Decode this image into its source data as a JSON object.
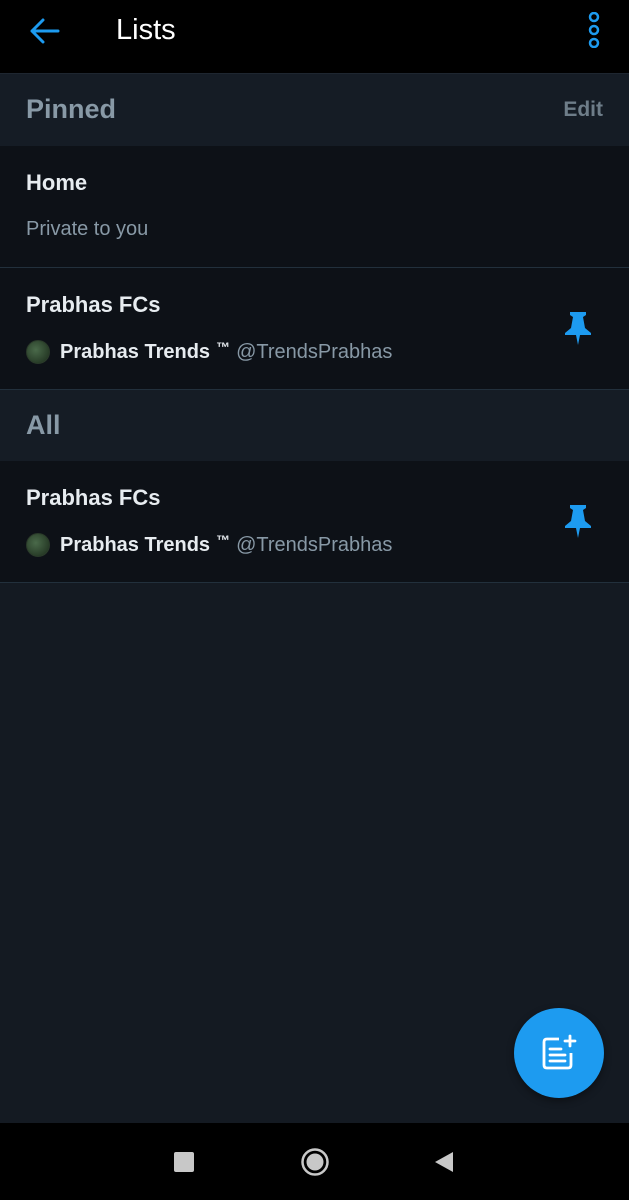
{
  "header": {
    "title": "Lists",
    "back_icon": "arrow-left-icon",
    "more_icon": "more-vertical-icon"
  },
  "pinned_section": {
    "label": "Pinned",
    "edit_label": "Edit",
    "items": [
      {
        "name": "Home",
        "subtitle": "Private to you"
      },
      {
        "name": "Prabhas FCs",
        "owner_name": "Prabhas Trends",
        "owner_mark": "™",
        "owner_handle": "@TrendsPrabhas",
        "pinned": true
      }
    ]
  },
  "all_section": {
    "label": "All",
    "items": [
      {
        "name": "Prabhas FCs",
        "owner_name": "Prabhas Trends",
        "owner_mark": "™",
        "owner_handle": "@TrendsPrabhas",
        "pinned": true
      }
    ]
  },
  "fab": {
    "icon": "new-list-icon"
  },
  "colors": {
    "accent": "#1d9bf0",
    "background": "#141a22",
    "row_background": "#0d1117",
    "muted_text": "#8899a6"
  }
}
